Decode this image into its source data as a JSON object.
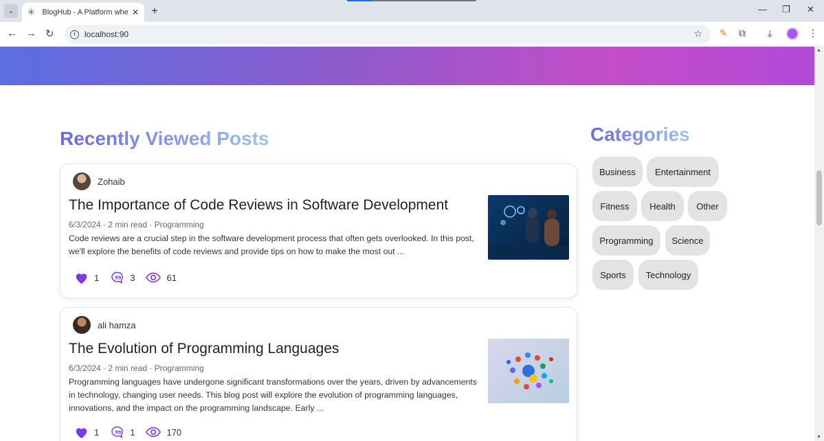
{
  "browser": {
    "tab_title": "BlogHub - A Platform where yo",
    "url": "localhost:90"
  },
  "main": {
    "section_title": "Recently Viewed Posts",
    "posts": [
      {
        "author": "Zohaib",
        "title": "The Importance of Code Reviews in Software Development",
        "meta": "6/3/2024 · 2 min read · Programming",
        "excerpt": "Code reviews are a crucial step in the software development process that often gets overlooked. In this post, we'll explore the benefits of code reviews and provide tips on how to make the most out ...",
        "likes": "1",
        "comments": "3",
        "views": "61"
      },
      {
        "author": "ali hamza",
        "title": "The Evolution of Programming Languages",
        "meta": "6/3/2024 · 2 min read · Programming",
        "excerpt": "Programming languages have undergone significant transformations over the years, driven by advancements in technology, changing user needs. This blog post will explore the evolution of programming languages, innovations, and the impact on the programming landscape. Early ...",
        "likes": "1",
        "comments": "1",
        "views": "170"
      }
    ]
  },
  "sidebar": {
    "title": "Categories",
    "categories": [
      "Business",
      "Entertainment",
      "Fitness",
      "Health",
      "Other",
      "Programming",
      "Science",
      "Sports",
      "Technology"
    ]
  },
  "colors": {
    "accent": "#7c3aed",
    "title_gradient_start": "#6a67e3",
    "title_gradient_end": "#9fc4ea"
  },
  "icons": [
    "heart-icon",
    "comment-icon",
    "eye-icon"
  ]
}
